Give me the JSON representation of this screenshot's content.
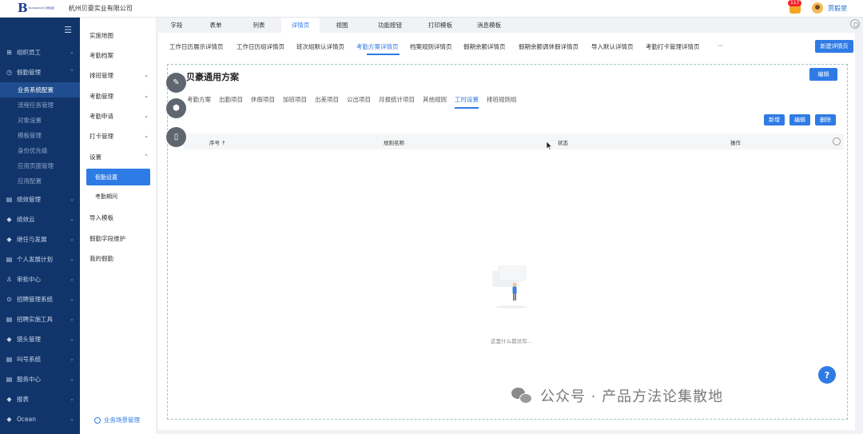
{
  "header": {
    "logo_letter": "B",
    "logo_small_text": "BAOSGROUP 贝豪集团",
    "company": "杭州贝豪实业有限公司",
    "notification_count": "117",
    "username": "贾毅堃"
  },
  "sidebar": {
    "items": [
      {
        "label": "组织员工",
        "icon": "org-icon"
      },
      {
        "label": "假勤管理",
        "icon": "clock-icon"
      },
      {
        "label": "绩效管理",
        "icon": "doc-icon"
      },
      {
        "label": "绩效云",
        "icon": "diamond-icon"
      },
      {
        "label": "继任与发展",
        "icon": "diamond-icon"
      },
      {
        "label": "个人发展计划",
        "icon": "doc-icon"
      },
      {
        "label": "审批中心",
        "icon": "user-icon"
      },
      {
        "label": "招聘管理系统",
        "icon": "search-icon"
      },
      {
        "label": "招聘实施工具",
        "icon": "doc-icon"
      },
      {
        "label": "猎头管理",
        "icon": "diamond-icon"
      },
      {
        "label": "叫号系统",
        "icon": "doc-icon"
      },
      {
        "label": "服务中心",
        "icon": "doc-icon"
      },
      {
        "label": "报表",
        "icon": "diamond-icon"
      },
      {
        "label": "Ocean",
        "icon": "diamond-icon"
      }
    ],
    "subitems": [
      {
        "label": "业务系统配置",
        "active": true
      },
      {
        "label": "流程任务管理"
      },
      {
        "label": "对象设置"
      },
      {
        "label": "模板管理"
      },
      {
        "label": "身份优先级"
      },
      {
        "label": "应用页面管理"
      },
      {
        "label": "应用配置"
      }
    ]
  },
  "col2": {
    "items": [
      {
        "label": "实施地图",
        "chev": ""
      },
      {
        "label": "考勤档案",
        "chev": ""
      },
      {
        "label": "排班管理",
        "chev": "⌄"
      },
      {
        "label": "考勤管理",
        "chev": "⌄"
      },
      {
        "label": "考勤申请",
        "chev": "⌄"
      },
      {
        "label": "打卡管理",
        "chev": "⌄"
      },
      {
        "label": "设置",
        "chev": "⌃"
      }
    ],
    "subitems": [
      {
        "label": "假勤设置",
        "active": true
      },
      {
        "label": "考勤期间"
      }
    ],
    "bottom_items": [
      {
        "label": "导入模板"
      },
      {
        "label": "假勤字段维护"
      },
      {
        "label": "我的假勤"
      }
    ],
    "footer": "业务场景管理"
  },
  "tabs": [
    {
      "label": "字段"
    },
    {
      "label": "表单"
    },
    {
      "label": "列表"
    },
    {
      "label": "详情页",
      "active": true
    },
    {
      "label": "视图"
    },
    {
      "label": "功能按钮"
    },
    {
      "label": "打印模板"
    },
    {
      "label": "消息模板"
    }
  ],
  "subtabs": [
    {
      "label": "工作日历展示详情页"
    },
    {
      "label": "工作日历组详情页"
    },
    {
      "label": "班次组默认详情页"
    },
    {
      "label": "考勤方案详情页",
      "active": true
    },
    {
      "label": "档案规则详情页"
    },
    {
      "label": "假期余额详情页"
    },
    {
      "label": "假期余额调休假详情页"
    },
    {
      "label": "导入默认详情页"
    },
    {
      "label": "考勤打卡管理详情页"
    },
    {
      "label": "···"
    }
  ],
  "new_detail_button": "新建详情页",
  "plan": {
    "title": "贝豪通用方案",
    "edit_button": "编辑",
    "inner_tabs": [
      {
        "label": "考勤方案"
      },
      {
        "label": "出勤项目"
      },
      {
        "label": "休假项目"
      },
      {
        "label": "加班项目"
      },
      {
        "label": "出差项目"
      },
      {
        "label": "公出项目"
      },
      {
        "label": "月报统计项目"
      },
      {
        "label": "其他规则"
      },
      {
        "label": "工时设置",
        "active": true
      },
      {
        "label": "排班规则组"
      }
    ],
    "actions": {
      "add": "新增",
      "edit": "编辑",
      "delete": "删除"
    },
    "columns": {
      "seq": "序号 ↑",
      "name": "规则名称",
      "status": "状态",
      "op": "操作"
    },
    "empty_text": "这里什么都没有..."
  },
  "help_label": "?",
  "watermark": "公众号 · 产品方法论集散地",
  "colors": {
    "primary": "#2f7be5",
    "sidebar": "#11356b"
  }
}
